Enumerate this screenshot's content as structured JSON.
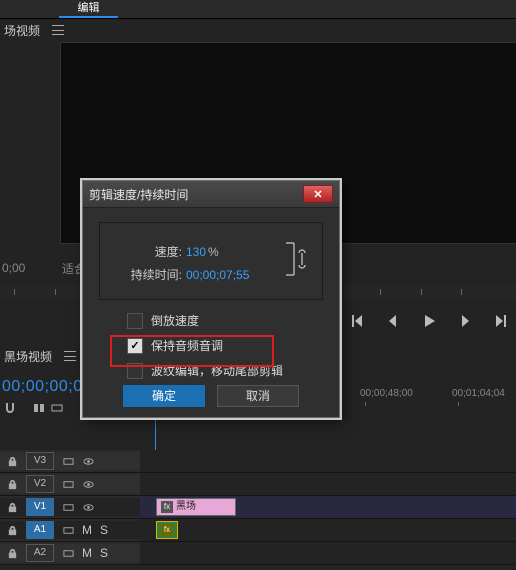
{
  "menu": {
    "items": [
      "",
      "编辑",
      "",
      "",
      "",
      ""
    ],
    "active": 1
  },
  "panel": {
    "left_tab": "场视频"
  },
  "program": {
    "tc": "0;00",
    "fit": "适合"
  },
  "transport": {
    "btns": [
      "goto-start",
      "step-back",
      "play",
      "step-fwd",
      "goto-end"
    ]
  },
  "sequence": {
    "tab": "黑场视频",
    "tc": "00;00;00;00"
  },
  "timeline": {
    "t1": "00;00;48;00",
    "t2": "00;01;04;04"
  },
  "tracks": {
    "v3": {
      "label": "V3"
    },
    "v2": {
      "label": "V2"
    },
    "v1": {
      "label": "V1",
      "clip_fx": "fx",
      "clip_name": "黑场"
    },
    "a1": {
      "label": "A1",
      "m": "M",
      "s": "S",
      "fx": "fx"
    },
    "a2": {
      "label": "A2",
      "m": "M",
      "s": "S"
    }
  },
  "dialog": {
    "title": "剪辑速度/持续时间",
    "speed_label": "速度:",
    "speed_value": "130",
    "speed_pct": "%",
    "duration_label": "持续时间:",
    "duration_value": "00;00;07;55",
    "opt_reverse": "倒放速度",
    "opt_pitch": "保持音频音调",
    "opt_ripple": "波纹编辑，移动尾部剪辑",
    "ok": "确定",
    "cancel": "取消"
  }
}
